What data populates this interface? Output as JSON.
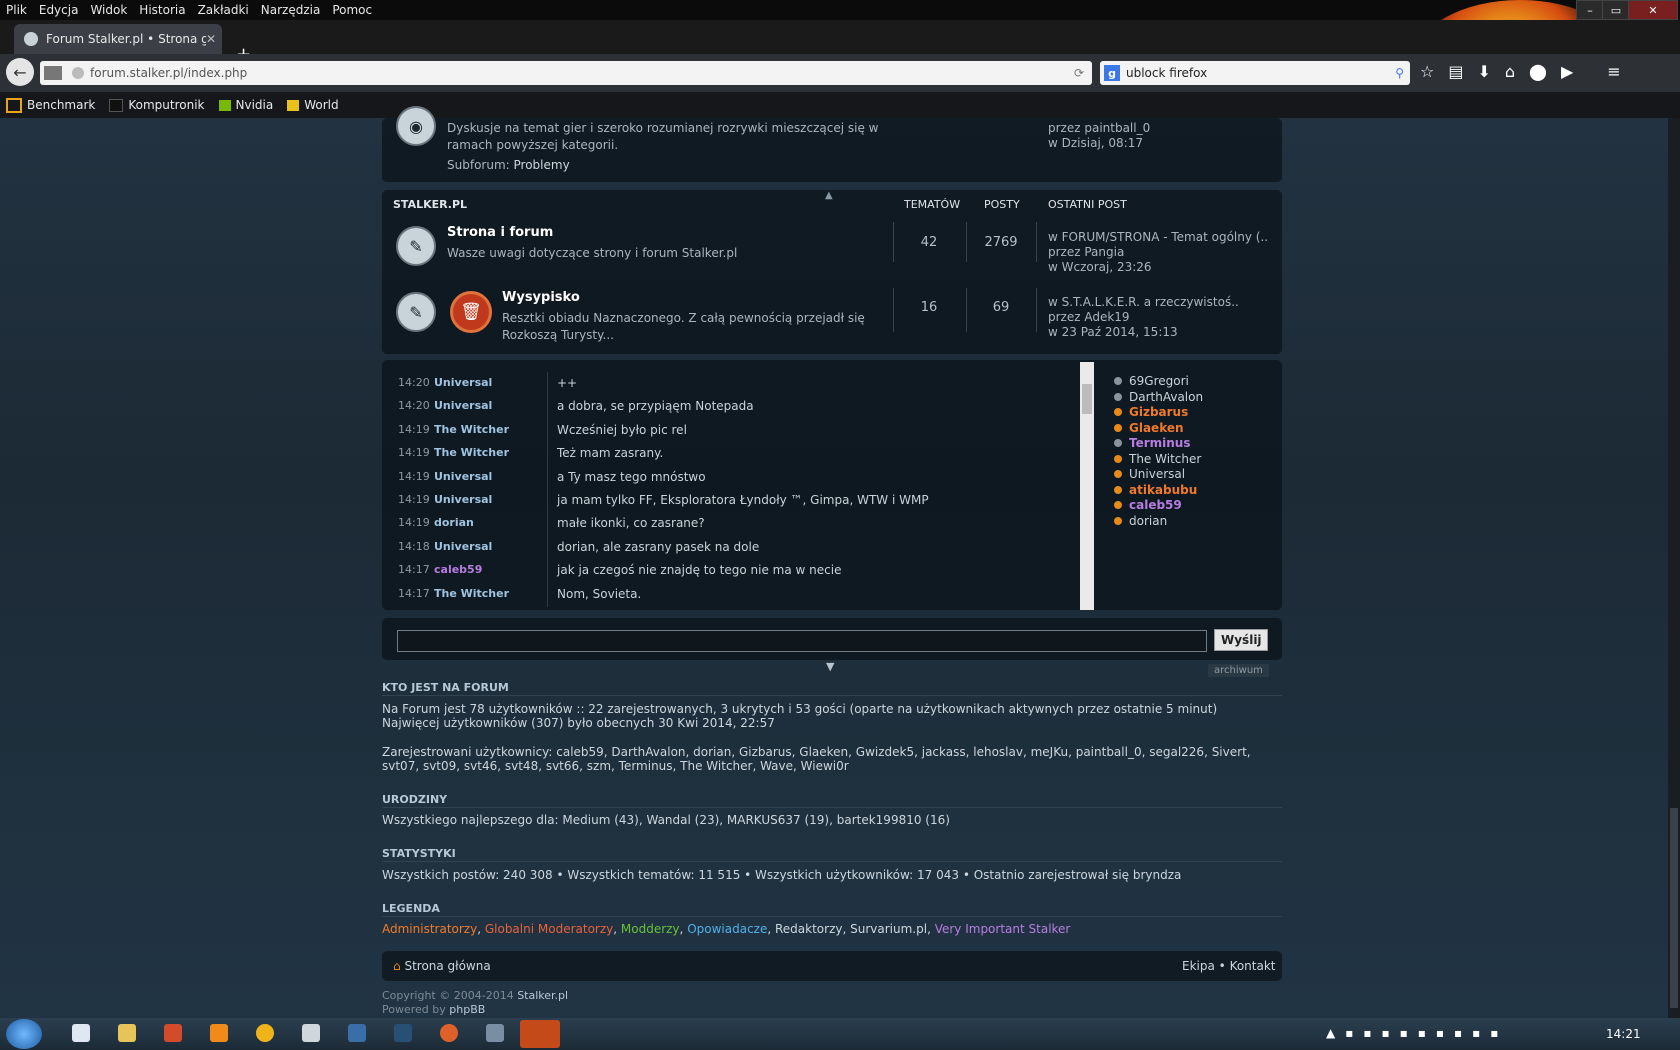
{
  "browser": {
    "menu": [
      "Plik",
      "Edycja",
      "Widok",
      "Historia",
      "Zakładki",
      "Narzędzia",
      "Pomoc"
    ],
    "tab_title": "Forum Stalker.pl • Strona g...",
    "url": "forum.stalker.pl/index.php",
    "search_value": "ublock firefox",
    "bookmarks": [
      "Benchmark",
      "Komputronik",
      "Nvidia",
      "World"
    ],
    "colors": {
      "chrome": "#2d3136",
      "accent": "#e88a1a"
    }
  },
  "top_category": {
    "desc_line1": "Dyskusje na temat gier i szeroko rozumianej rozrywki mieszczącej się w",
    "desc_line2": "ramach powyższej kategorii.",
    "subforum_label": "Subforum:",
    "subforum_link": "Problemy",
    "last_by": "przez paintball_0",
    "last_when": "w Dzisiaj, 08:17"
  },
  "category": {
    "name": "STALKER.PL",
    "col_topics": "TEMATÓW",
    "col_posts": "POSTY",
    "col_last": "OSTATNI POST",
    "forums": [
      {
        "title": "Strona i forum",
        "desc1": "Wasze uwagi dotyczące strony i forum Stalker.pl",
        "desc2": "",
        "topics": "42",
        "posts": "2769",
        "last1": "w FORUM/STRONA - Temat ogólny (..",
        "last2": "przez Pangia",
        "last3": "w Wczoraj, 23:26"
      },
      {
        "title": "Wysypisko",
        "desc1": "Resztki obiadu Naznaczonego. Z całą pewnością przejadł się",
        "desc2": "Rozkoszą Turysty...",
        "topics": "16",
        "posts": "69",
        "last1": "w S.T.A.L.K.E.R. a rzeczywistoś..",
        "last2": "przez Adek19",
        "last3": "w 23 Paź 2014, 15:13"
      }
    ]
  },
  "shoutbox": {
    "messages": [
      {
        "time": "14:20",
        "user": "Universal",
        "color": "#9fc3e0",
        "text": "++"
      },
      {
        "time": "14:20",
        "user": "Universal",
        "color": "#9fc3e0",
        "text": "a dobra, se przypiąęm Notepada"
      },
      {
        "time": "14:19",
        "user": "The Witcher",
        "color": "#9fc3e0",
        "text": "Wcześniej było pic rel"
      },
      {
        "time": "14:19",
        "user": "The Witcher",
        "color": "#9fc3e0",
        "text": "Też mam zasrany."
      },
      {
        "time": "14:19",
        "user": "Universal",
        "color": "#9fc3e0",
        "text": "a Ty masz tego mnóstwo"
      },
      {
        "time": "14:19",
        "user": "Universal",
        "color": "#9fc3e0",
        "text": "ja mam tylko FF, Eksploratora Łyndoły ™, Gimpa, WTW i WMP"
      },
      {
        "time": "14:19",
        "user": "dorian",
        "color": "#9fc3e0",
        "text": "małe ikonki, co zasrane?"
      },
      {
        "time": "14:18",
        "user": "Universal",
        "color": "#9fc3e0",
        "text": "dorian, ale zasrany pasek na dole"
      },
      {
        "time": "14:17",
        "user": "caleb59",
        "color": "#b77de0",
        "text": "jak ja czegoś nie znajdę to tego nie ma w necie"
      },
      {
        "time": "14:17",
        "user": "The Witcher",
        "color": "#9fc3e0",
        "text": "Nom, Sovieta."
      }
    ],
    "online": [
      {
        "name": "69Gregori",
        "color": "#c9d3da",
        "dot": "#8a949b",
        "bold": false
      },
      {
        "name": "DarthAvalon",
        "color": "#c9d3da",
        "dot": "#8a949b",
        "bold": false
      },
      {
        "name": "Gizbarus",
        "color": "#f07a2a",
        "dot": "#e88a1a",
        "bold": true
      },
      {
        "name": "Glaeken",
        "color": "#f07a2a",
        "dot": "#e88a1a",
        "bold": true
      },
      {
        "name": "Terminus",
        "color": "#b77de0",
        "dot": "#8a949b",
        "bold": true
      },
      {
        "name": "The Witcher",
        "color": "#c9d3da",
        "dot": "#e88a1a",
        "bold": false
      },
      {
        "name": "Universal",
        "color": "#c9d3da",
        "dot": "#e88a1a",
        "bold": false
      },
      {
        "name": "atikabubu",
        "color": "#f07a2a",
        "dot": "#e88a1a",
        "bold": true
      },
      {
        "name": "caleb59",
        "color": "#b77de0",
        "dot": "#e88a1a",
        "bold": true
      },
      {
        "name": "dorian",
        "color": "#c9d3da",
        "dot": "#e88a1a",
        "bold": false
      }
    ],
    "send_label": "Wyślij",
    "archive_label": "archiwum"
  },
  "who": {
    "title": "KTO JEST NA FORUM",
    "line1": "Na Forum jest 78 użytkowników :: 22 zarejestrowanych, 3 ukrytych i 53 gości (oparte na użytkownikach aktywnych przez ostatnie 5 minut)",
    "line2": "Najwięcej użytkowników (307) było obecnych 30 Kwi 2014, 22:57",
    "line3": "Zarejestrowani użytkownicy: caleb59, DarthAvalon, dorian, Gizbarus, Glaeken, Gwizdek5, jackass, lehoslav, meJKu, paintball_0, segal226, Sivert,",
    "line4": "svt07, svt09, svt46, svt48, svt66, szm, Terminus, The Witcher, Wave, Wiewi0r"
  },
  "birthdays": {
    "title": "URODZINY",
    "line": "Wszystkiego najlepszego dla: Medium (43), Wandal (23), MARKUS637 (19), bartek199810 (16)"
  },
  "stats": {
    "title": "STATYSTYKI",
    "line": "Wszystkich postów: 240 308 • Wszystkich tematów: 11 515 • Wszystkich użytkowników: 17 043 • Ostatnio zarejestrował się bryndza"
  },
  "legend": {
    "title": "LEGENDA",
    "items": [
      {
        "label": "Administratorzy",
        "color": "#f07a2a"
      },
      {
        "label": "Globalni Moderatorzy",
        "color": "#e8623a"
      },
      {
        "label": "Modderzy",
        "color": "#67c23a"
      },
      {
        "label": "Opowiadacze",
        "color": "#4fb2e8"
      },
      {
        "label": "Redaktorzy",
        "color": "#cdd6dc"
      },
      {
        "label": "Survarium.pl",
        "color": "#cdd6dc"
      },
      {
        "label": "Very Important Stalker",
        "color": "#b77de0"
      }
    ]
  },
  "footer": {
    "home": "Strona główna",
    "team": "Ekipa",
    "contact": "Kontakt",
    "copyright": "Copyright © 2004-2014",
    "site": "Stalker.pl",
    "powered": "Powered by",
    "phpbb": "phpBB"
  },
  "taskbar": {
    "clock": "14:21"
  }
}
